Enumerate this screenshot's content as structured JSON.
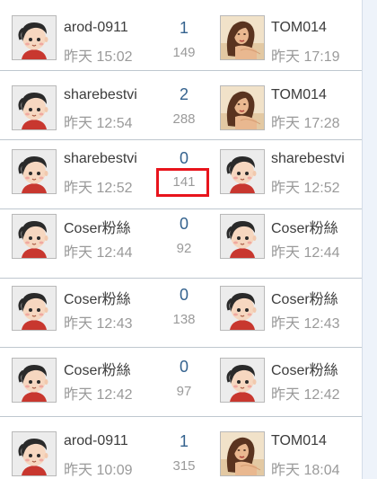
{
  "colors": {
    "accent_number": "#34628e",
    "muted_text": "#9a9a9a",
    "title_text": "#3c3c3c",
    "divider": "#bfc7cf",
    "highlight_box": "#e8141c"
  },
  "rows": [
    {
      "author": "arod-0911",
      "author_time": "昨天 15:02",
      "author_avatar_icon": "boy-avatar-icon",
      "replies": "1",
      "views": "149",
      "last_poster": "TOM014",
      "last_time": "昨天 17:19",
      "last_avatar_icon": "woman-photo-avatar-icon"
    },
    {
      "author": "sharebestvi",
      "author_time": "昨天 12:54",
      "author_avatar_icon": "boy-avatar-icon",
      "replies": "2",
      "views": "288",
      "last_poster": "TOM014",
      "last_time": "昨天 17:28",
      "last_avatar_icon": "woman-photo-avatar-icon"
    },
    {
      "author": "sharebestvi",
      "author_time": "昨天 12:52",
      "author_avatar_icon": "boy-avatar-icon",
      "replies": "0",
      "views": "141",
      "last_poster": "sharebestvi",
      "last_time": "昨天 12:52",
      "last_avatar_icon": "boy-avatar-icon",
      "views_highlighted": true
    },
    {
      "author": "Coser粉絲",
      "author_time": "昨天 12:44",
      "author_avatar_icon": "boy-avatar-icon",
      "replies": "0",
      "views": "92",
      "last_poster": "Coser粉絲",
      "last_time": "昨天 12:44",
      "last_avatar_icon": "boy-avatar-icon"
    },
    {
      "author": "Coser粉絲",
      "author_time": "昨天 12:43",
      "author_avatar_icon": "boy-avatar-icon",
      "replies": "0",
      "views": "138",
      "last_poster": "Coser粉絲",
      "last_time": "昨天 12:43",
      "last_avatar_icon": "boy-avatar-icon"
    },
    {
      "author": "Coser粉絲",
      "author_time": "昨天 12:42",
      "author_avatar_icon": "boy-avatar-icon",
      "replies": "0",
      "views": "97",
      "last_poster": "Coser粉絲",
      "last_time": "昨天 12:42",
      "last_avatar_icon": "boy-avatar-icon"
    },
    {
      "author": "arod-0911",
      "author_time": "昨天 10:09",
      "author_avatar_icon": "boy-avatar-icon",
      "replies": "1",
      "views": "315",
      "last_poster": "TOM014",
      "last_time": "昨天 18:04",
      "last_avatar_icon": "woman-photo-avatar-icon"
    }
  ]
}
